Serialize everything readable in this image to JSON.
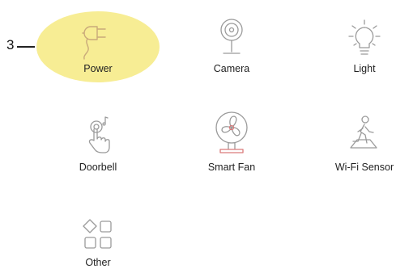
{
  "callout": {
    "number": "3"
  },
  "devices": [
    {
      "label": "Power",
      "icon": "power-plug-icon"
    },
    {
      "label": "Camera",
      "icon": "camera-icon"
    },
    {
      "label": "Light",
      "icon": "light-bulb-icon"
    },
    {
      "label": "Doorbell",
      "icon": "doorbell-icon"
    },
    {
      "label": "Smart Fan",
      "icon": "fan-icon"
    },
    {
      "label": "Wi-Fi Sensor",
      "icon": "motion-sensor-icon"
    },
    {
      "label": "Other",
      "icon": "other-grid-icon"
    }
  ],
  "colors": {
    "highlight": "#f7ec8e",
    "icon_gray": "#9a9a9a",
    "fan_accent": "#d97a7a"
  }
}
